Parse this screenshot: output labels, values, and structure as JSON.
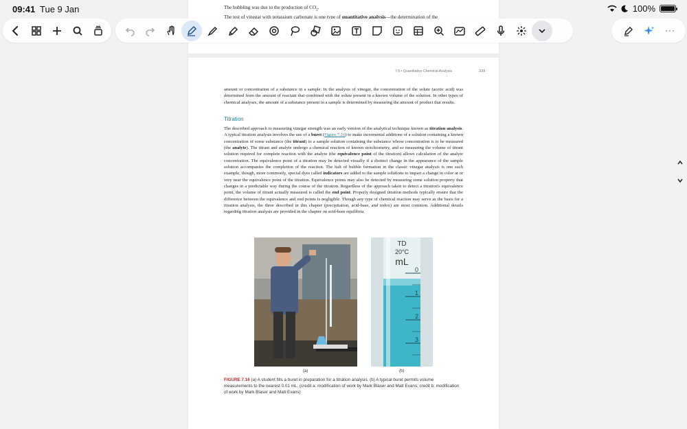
{
  "status": {
    "time": "09:41",
    "date": "Tue 9 Jan",
    "battery": "100%"
  },
  "toolbar": {
    "left": [
      "back-icon",
      "grid-icon",
      "add-icon",
      "search-icon",
      "layers-icon"
    ],
    "mid": [
      "undo-icon",
      "redo-icon",
      "hand-icon",
      "pen-icon",
      "brush-icon",
      "highlighter-icon",
      "eraser-icon",
      "lasso-circle-icon",
      "lasso-icon",
      "shapes-icon",
      "image-icon",
      "text-icon",
      "sticky-note-icon",
      "sticker-icon",
      "table-icon",
      "zoom-icon",
      "chart-icon",
      "ruler-icon",
      "mic-icon",
      "laser-icon",
      "chevron-down-icon"
    ],
    "right": [
      "ai-pen-icon",
      "sparkle-icon",
      "more-icon"
    ]
  },
  "document": {
    "prev_line1": "The bubbling was due to the production of CO",
    "prev_line1_sub": "2",
    "prev_line1_end": ".",
    "prev_line2_a": "The test of vinegar with potassium carbonate is one type of ",
    "prev_line2_b": "quantitative analysis",
    "prev_line2_c": "—the determination of the",
    "running_head": "7.5 • Quantitative Chemical Analysis",
    "page_number": "339",
    "para1": "amount or concentration of a substance in a sample. In the analysis of vinegar, the concentration of the solute (acetic acid) was determined from the amount of reactant that combined with the solute present in a known volume of the solution. In other types of chemical analyses, the amount of a substance present in a sample is determined by measuring the amount of product that results.",
    "heading": "Titration",
    "p2_1": "The described approach to measuring vinegar strength was an early version of the analytical technique known as ",
    "p2_b1": "titration analysis",
    "p2_2": ". A typical titration analysis involves the use of a ",
    "p2_b2": "buret",
    "p2_3": " (",
    "p2_link": "Figure 7.16",
    "p2_4": ") to make incremental additions of a solution containing a known concentration of some substance (the ",
    "p2_b3": "titrant",
    "p2_5": ") to a sample solution containing the substance whose concentration is to be measured (the ",
    "p2_b4": "analyte",
    "p2_6": "). The titrant and analyte undergo a chemical reaction of known stoichiometry, and so measuring the volume of titrant solution required for complete reaction with the analyte (the ",
    "p2_b5": "equivalence point",
    "p2_7": " of the titration) allows calculation of the analyte concentration. The equivalence point of a titration may be detected visually if a distinct change in the appearance of the sample solution accompanies the completion of the reaction. The halt of bubble formation in the classic vinegar analysis is one such example, though, more commonly, special dyes called ",
    "p2_b6": "indicators",
    "p2_8": " are added to the sample solutions to impart a change in color at or very near the equivalence point of the titration. Equivalence points may also be detected by measuring some solution property that changes in a predictable way during the course of the titration. Regardless of the approach taken to detect a titration's equivalence point, the volume of titrant actually measured is called the ",
    "p2_b7": "end point",
    "p2_9": ". Properly designed titration methods typically ensure that the difference between the equivalence and end points is negligible. Though any type of chemical reaction may serve as the basis for a titration analysis, the three described in this chapter (precipitation, acid-base, and redox) are most common. Additional details regarding titration analysis are provided in the chapter on acid-base equilibria.",
    "label_a": "(a)",
    "label_b": "(b)",
    "buret_td": "TD",
    "buret_temp": "20°C",
    "buret_unit": "mL",
    "buret_marks": [
      "0",
      "1",
      "2",
      "3"
    ],
    "figure_label": "FIGURE 7.16",
    "caption": "(a) A student fills a buret in preparation for a titration analysis. (b) A typical buret permits volume measurements to the nearest 0.01 mL. (credit a: modification of work by Mark Blaser and Matt Evans; credit b: modification of work by Mark Blaser and Matt Evans)"
  }
}
